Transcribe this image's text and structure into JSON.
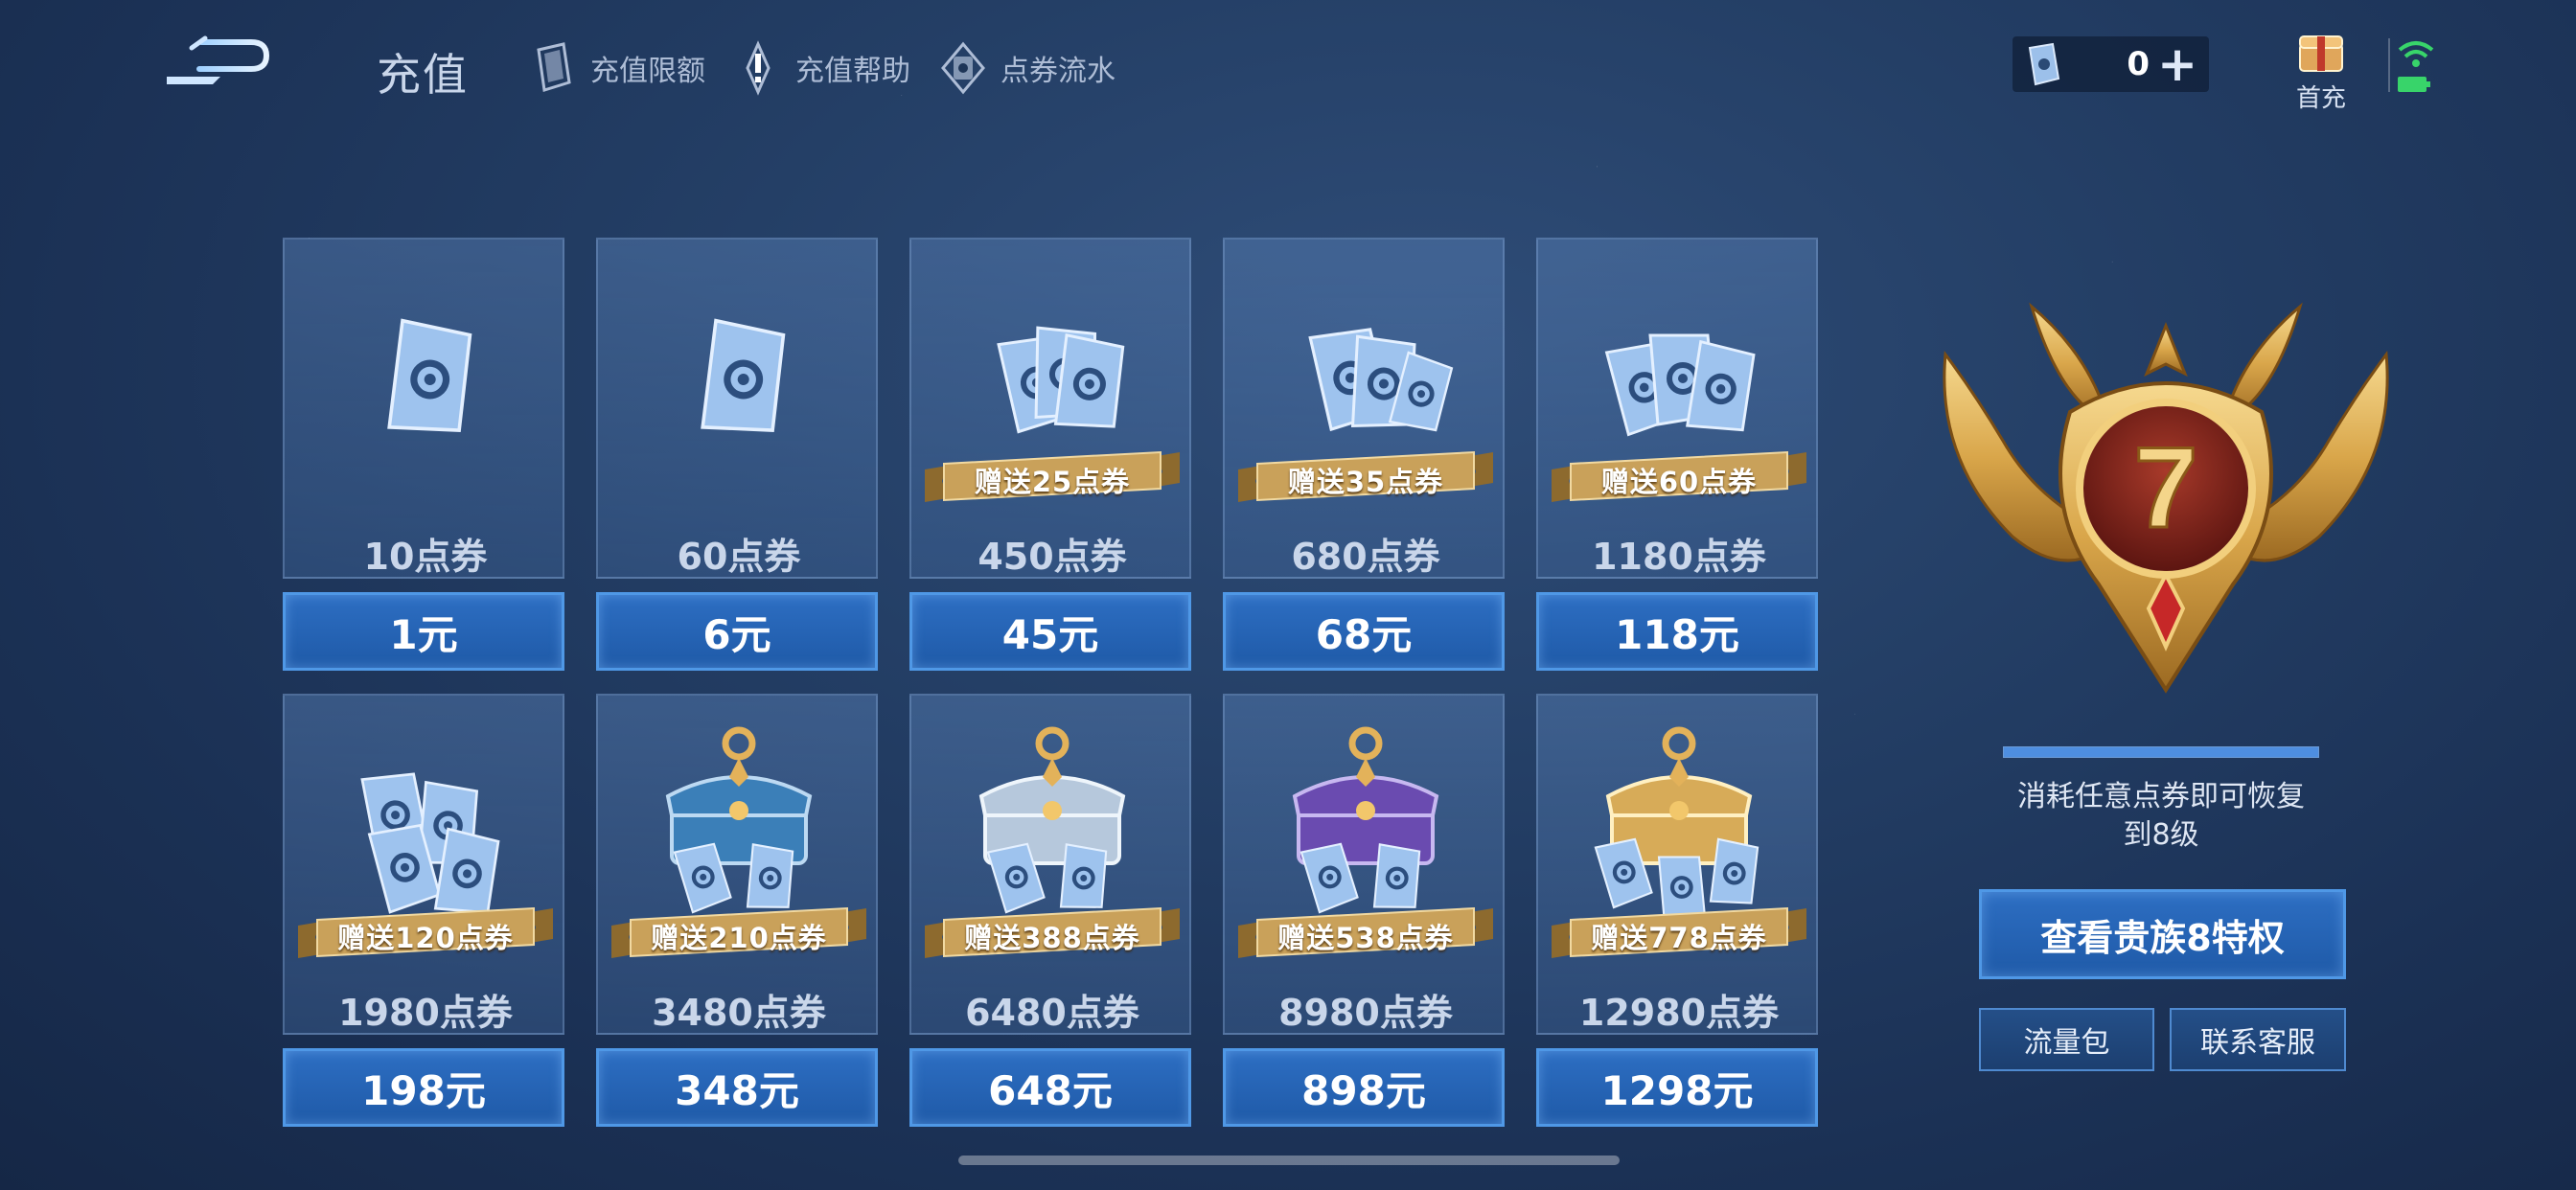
{
  "header": {
    "title": "充值",
    "links": [
      {
        "label": "充值限额",
        "icon": "coupon-card-icon"
      },
      {
        "label": "充值帮助",
        "icon": "exclamation-icon"
      },
      {
        "label": "点券流水",
        "icon": "coupon-flow-icon"
      }
    ],
    "balance": "0",
    "first_charge_label": "首充"
  },
  "packages": [
    {
      "amount": "10点券",
      "price": "1元",
      "bonus": "",
      "art": "single-card"
    },
    {
      "amount": "60点券",
      "price": "6元",
      "bonus": "",
      "art": "single-card"
    },
    {
      "amount": "450点券",
      "price": "45元",
      "bonus": "赠送25点券",
      "art": "card-stack-small"
    },
    {
      "amount": "680点券",
      "price": "68元",
      "bonus": "赠送35点券",
      "art": "card-stack-medium"
    },
    {
      "amount": "1180点券",
      "price": "118元",
      "bonus": "赠送60点券",
      "art": "card-stack-large"
    },
    {
      "amount": "1980点券",
      "price": "198元",
      "bonus": "赠送120点券",
      "art": "card-pile"
    },
    {
      "amount": "3480点券",
      "price": "348元",
      "bonus": "赠送210点券",
      "art": "chest-blue"
    },
    {
      "amount": "6480点券",
      "price": "648元",
      "bonus": "赠送388点券",
      "art": "chest-silver"
    },
    {
      "amount": "8980点券",
      "price": "898元",
      "bonus": "赠送538点券",
      "art": "chest-purple"
    },
    {
      "amount": "12980点券",
      "price": "1298元",
      "bonus": "赠送778点券",
      "art": "chest-gold"
    }
  ],
  "vip": {
    "level": "7",
    "progress": 1.0,
    "note_line1": "消耗任意点券即可恢复",
    "note_line2": "到8级",
    "privilege_button": "查看贵族8特权",
    "data_pack_button": "流量包",
    "support_button": "联系客服"
  },
  "colors": {
    "button_blue": "#2d6ec2",
    "ribbon_gold": "#c9a15a",
    "emblem_gold": "#d9a64a",
    "emblem_red": "#7a1f1a"
  }
}
